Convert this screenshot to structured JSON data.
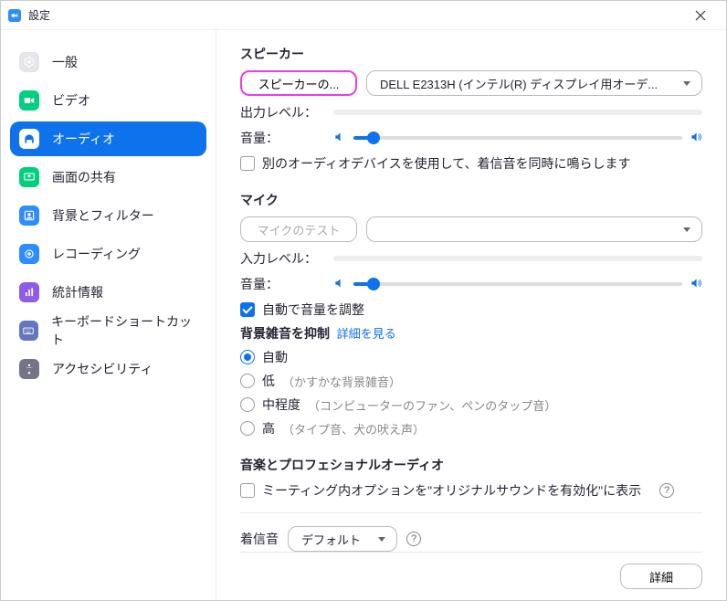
{
  "window": {
    "title": "設定"
  },
  "sidebar": {
    "items": [
      {
        "label": "一般"
      },
      {
        "label": "ビデオ"
      },
      {
        "label": "オーディオ"
      },
      {
        "label": "画面の共有"
      },
      {
        "label": "背景とフィルター"
      },
      {
        "label": "レコーディング"
      },
      {
        "label": "統計情報"
      },
      {
        "label": "キーボードショートカット"
      },
      {
        "label": "アクセシビリティ"
      }
    ]
  },
  "speaker": {
    "title": "スピーカー",
    "test_button": "スピーカーの...",
    "device": "DELL E2313H (インテル(R) ディスプレイ用オーデ...",
    "output_level_label": "出力レベル：",
    "volume_label": "音量：",
    "ringtone_checkbox": "別のオーディオデバイスを使用して、着信音を同時に鳴らします"
  },
  "mic": {
    "title": "マイク",
    "test_button": "マイクのテスト",
    "input_level_label": "入力レベル：",
    "volume_label": "音量：",
    "auto_adjust": "自動で音量を調整",
    "noise_suppress_title": "背景雑音を抑制",
    "detail_link": "詳細を見る",
    "options": {
      "auto": "自動",
      "low": "低",
      "low_hint": "（かすかな背景雑音）",
      "mid": "中程度",
      "mid_hint": "（コンピューターのファン、ペンのタップ音）",
      "high": "高",
      "high_hint": "（タイプ音、犬の吠え声）"
    }
  },
  "music": {
    "title": "音楽とプロフェショナルオーディオ",
    "option": "ミーティング内オプションを\"オリジナルサウンドを有効化\"に表示"
  },
  "ringtone": {
    "label": "着信音",
    "value": "デフォルト"
  },
  "footer": {
    "advanced": "詳細"
  }
}
